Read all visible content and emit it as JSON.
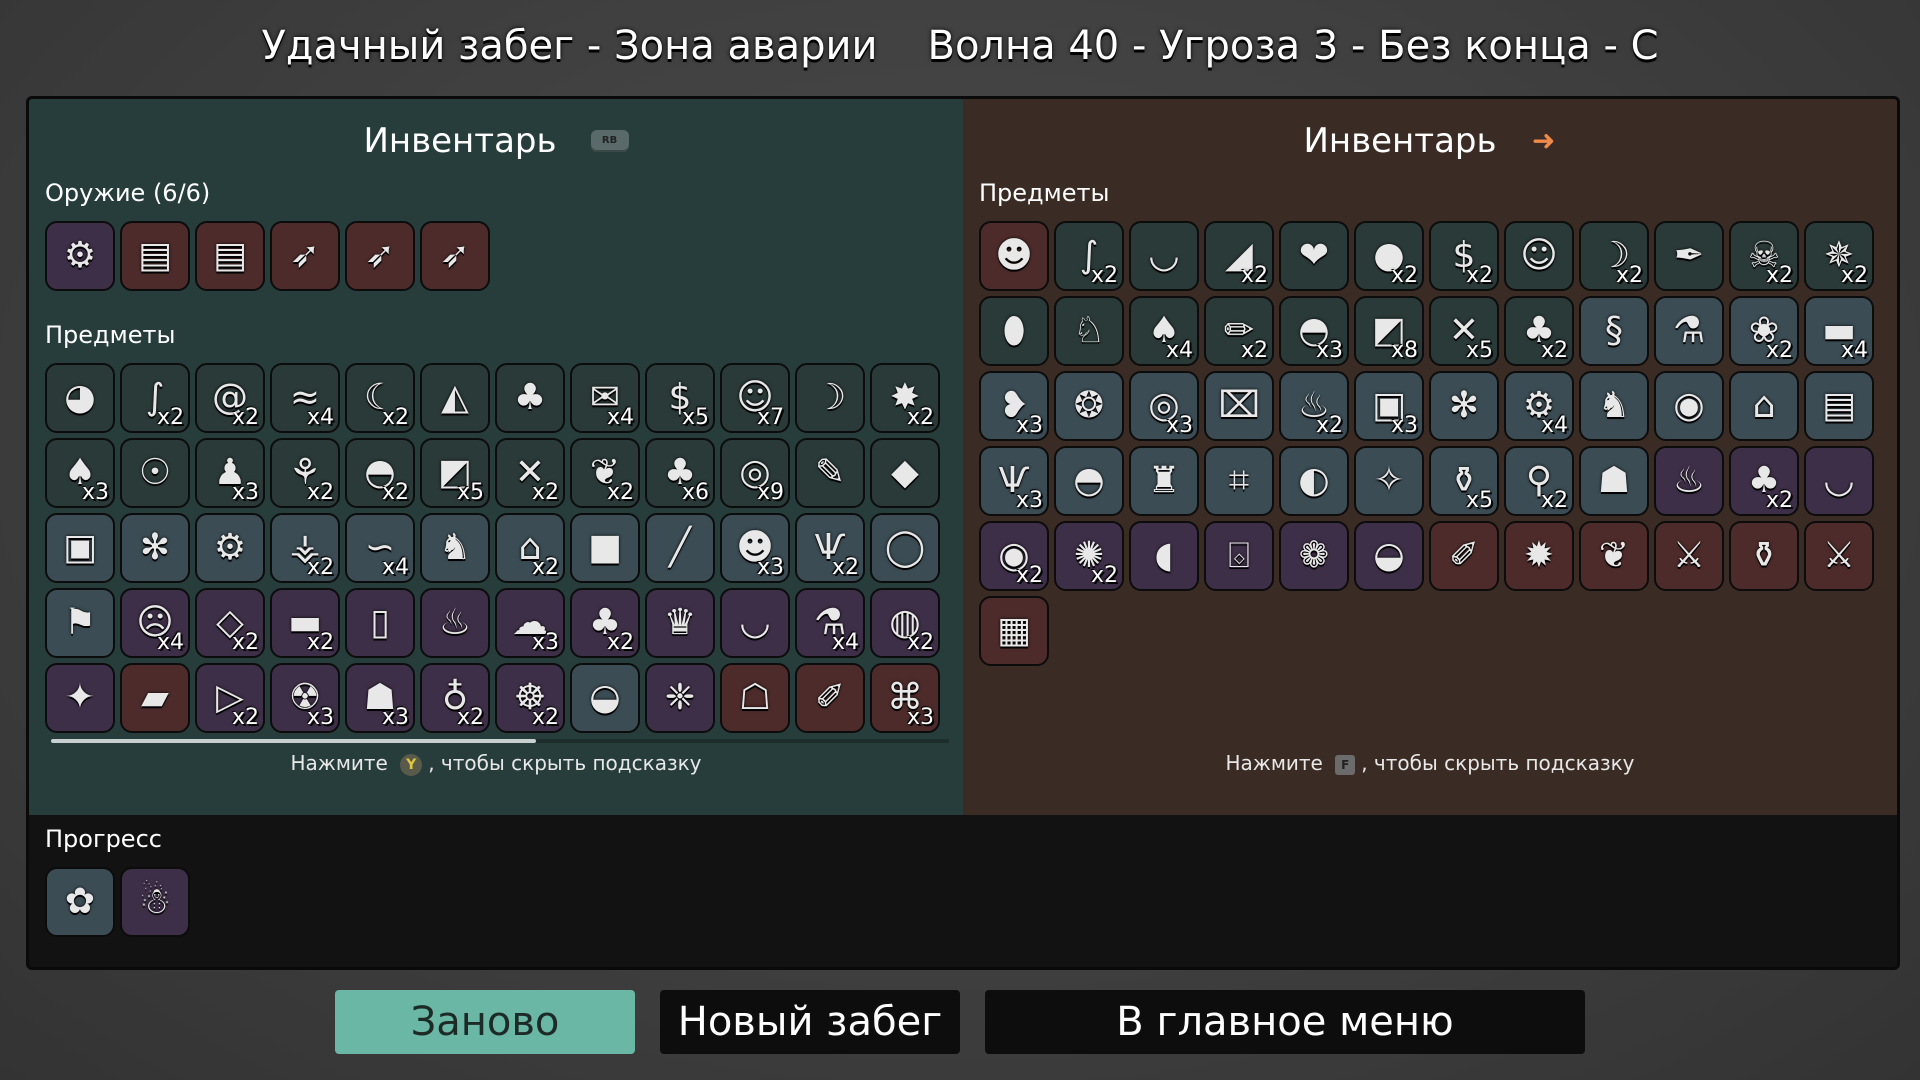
{
  "title": {
    "left": "Удачный забег - Зона аварии",
    "right": "Волна 40 - Угроза 3 - Без конца - С"
  },
  "left_panel": {
    "header": "Инвентарь",
    "header_chip": "RB",
    "weapons_label": "Оружие (6/6)",
    "weapons": [
      {
        "icon": "minigun-icon",
        "glyph": "⚙",
        "tier": 2
      },
      {
        "icon": "gatling-icon",
        "glyph": "▤",
        "tier": 3
      },
      {
        "icon": "gatling-icon",
        "glyph": "▤",
        "tier": 3
      },
      {
        "icon": "rocket-launcher-icon",
        "glyph": "➶",
        "tier": 3
      },
      {
        "icon": "rocket-launcher-icon",
        "glyph": "➶",
        "tier": 3
      },
      {
        "icon": "rocket-launcher-icon",
        "glyph": "➶",
        "tier": 3
      }
    ],
    "items_label": "Предметы",
    "items": [
      {
        "icon": "egg-glasses-icon",
        "glyph": "◕",
        "count": "",
        "tier": 0
      },
      {
        "icon": "worm-icon",
        "glyph": "∫",
        "count": "x2",
        "tier": 0
      },
      {
        "icon": "snail-icon",
        "glyph": "@",
        "count": "x2",
        "tier": 0
      },
      {
        "icon": "lizard-icon",
        "glyph": "≈",
        "count": "x4",
        "tier": 0
      },
      {
        "icon": "claw-icon",
        "glyph": "☾",
        "count": "x2",
        "tier": 0
      },
      {
        "icon": "cake-icon",
        "glyph": "◭",
        "count": "",
        "tier": 0
      },
      {
        "icon": "palm-tree-icon",
        "glyph": "♣",
        "count": "",
        "tier": 0
      },
      {
        "icon": "scroll-icon",
        "glyph": "✉",
        "count": "x4",
        "tier": 0
      },
      {
        "icon": "cash-icon",
        "glyph": "$",
        "count": "x5",
        "tier": 0
      },
      {
        "icon": "monkey-icon",
        "glyph": "☺",
        "count": "x7",
        "tier": 0
      },
      {
        "icon": "crescent-icon",
        "glyph": "☽",
        "count": "",
        "tier": 0
      },
      {
        "icon": "dynamite-icon",
        "glyph": "✸",
        "count": "x2",
        "tier": 0
      },
      {
        "icon": "mushroom-icon",
        "glyph": "♠",
        "count": "x3",
        "tier": 0
      },
      {
        "icon": "ghost-icon",
        "glyph": "☉",
        "count": "",
        "tier": 0
      },
      {
        "icon": "penguin-icon",
        "glyph": "♟",
        "count": "x3",
        "tier": 0
      },
      {
        "icon": "sprout-icon",
        "glyph": "⚘",
        "count": "x2",
        "tier": 0
      },
      {
        "icon": "propeller-hat-icon",
        "glyph": "◓",
        "count": "x2",
        "tier": 0
      },
      {
        "icon": "cheese-icon",
        "glyph": "◩",
        "count": "x5",
        "tier": 0
      },
      {
        "icon": "branch-icon",
        "glyph": "✕",
        "count": "x2",
        "tier": 0
      },
      {
        "icon": "meat-icon",
        "glyph": "❦",
        "count": "x2",
        "tier": 0
      },
      {
        "icon": "tree-icon",
        "glyph": "♣",
        "count": "x6",
        "tier": 0
      },
      {
        "icon": "medal-icon",
        "glyph": "◎",
        "count": "x9",
        "tier": 0
      },
      {
        "icon": "tag-icon",
        "glyph": "✎",
        "count": "",
        "tier": 0
      },
      {
        "icon": "whistle-icon",
        "glyph": "◆",
        "count": "",
        "tier": 0
      },
      {
        "icon": "box-icon",
        "glyph": "▣",
        "count": "",
        "tier": 1
      },
      {
        "icon": "wasp-icon",
        "glyph": "✻",
        "count": "",
        "tier": 1
      },
      {
        "icon": "gear-icon",
        "glyph": "⚙",
        "count": "",
        "tier": 1
      },
      {
        "icon": "coral-icon",
        "glyph": "⚶",
        "count": "x2",
        "tier": 1
      },
      {
        "icon": "larva-icon",
        "glyph": "∽",
        "count": "x4",
        "tier": 1
      },
      {
        "icon": "rabbit-icon",
        "glyph": "♞",
        "count": "",
        "tier": 1
      },
      {
        "icon": "planter-icon",
        "glyph": "⌂",
        "count": "x2",
        "tier": 1
      },
      {
        "icon": "ice-cube-icon",
        "glyph": "■",
        "count": "",
        "tier": 1
      },
      {
        "icon": "plank-icon",
        "glyph": "╱",
        "count": "",
        "tier": 1
      },
      {
        "icon": "frog-icon",
        "glyph": "☻",
        "count": "x3",
        "tier": 1
      },
      {
        "icon": "horns-icon",
        "glyph": "Ѱ",
        "count": "x2",
        "tier": 1
      },
      {
        "icon": "pendant-icon",
        "glyph": "◯",
        "count": "",
        "tier": 1
      },
      {
        "icon": "flag-icon",
        "glyph": "⚑",
        "count": "",
        "tier": 1
      },
      {
        "icon": "imp-icon",
        "glyph": "☹",
        "count": "x4",
        "tier": 2
      },
      {
        "icon": "eraser-icon",
        "glyph": "◇",
        "count": "x2",
        "tier": 2
      },
      {
        "icon": "log-icon",
        "glyph": "▬",
        "count": "x2",
        "tier": 2
      },
      {
        "icon": "mirror-icon",
        "glyph": "▯",
        "count": "",
        "tier": 2
      },
      {
        "icon": "candle-icon",
        "glyph": "♨",
        "count": "",
        "tier": 2
      },
      {
        "icon": "cloud-icon",
        "glyph": "☁",
        "count": "x3",
        "tier": 2
      },
      {
        "icon": "clover-icon",
        "glyph": "♣",
        "count": "x2",
        "tier": 2
      },
      {
        "icon": "crown-icon",
        "glyph": "♛",
        "count": "",
        "tier": 2
      },
      {
        "icon": "ramen-bowl-icon",
        "glyph": "◡",
        "count": "",
        "tier": 2
      },
      {
        "icon": "bottle-icon",
        "glyph": "⚗",
        "count": "x4",
        "tier": 2
      },
      {
        "icon": "fishbowl-icon",
        "glyph": "◍",
        "count": "x2",
        "tier": 2
      },
      {
        "icon": "chicken-icon",
        "glyph": "✦",
        "count": "",
        "tier": 2
      },
      {
        "icon": "toolbox-icon",
        "glyph": "▰",
        "count": "",
        "tier": 3
      },
      {
        "icon": "triangle-icon",
        "glyph": "▷",
        "count": "x2",
        "tier": 2
      },
      {
        "icon": "alien-icon",
        "glyph": "☢",
        "count": "x3",
        "tier": 2
      },
      {
        "icon": "ninja-icon",
        "glyph": "☗",
        "count": "x3",
        "tier": 2
      },
      {
        "icon": "potion-icon",
        "glyph": "♁",
        "count": "x2",
        "tier": 2
      },
      {
        "icon": "angel-icon",
        "glyph": "☸",
        "count": "x2",
        "tier": 2
      },
      {
        "icon": "helmet-icon",
        "glyph": "◒",
        "count": "",
        "tier": 1
      },
      {
        "icon": "wings-icon",
        "glyph": "❈",
        "count": "",
        "tier": 2
      },
      {
        "icon": "head-icon",
        "glyph": "☖",
        "count": "",
        "tier": 3
      },
      {
        "icon": "scroll-rolled-icon",
        "glyph": "✐",
        "count": "",
        "tier": 3
      },
      {
        "icon": "robot-frame-icon",
        "glyph": "⌘",
        "count": "x3",
        "tier": 3
      }
    ],
    "hint_prefix": "Нажмите",
    "hint_button": "Y",
    "hint_suffix": ", чтобы скрыть подсказку",
    "scroll_fraction": 0.54
  },
  "right_panel": {
    "header": "Инвентарь",
    "header_icon": "arrow-right-icon",
    "items_label": "Предметы",
    "items": [
      {
        "icon": "character-face-icon",
        "glyph": "☻",
        "count": "",
        "tier": 3
      },
      {
        "icon": "worm-icon",
        "glyph": "∫",
        "count": "x2",
        "tier": 0
      },
      {
        "icon": "cauldron-icon",
        "glyph": "◡",
        "count": "",
        "tier": 0
      },
      {
        "icon": "blade-icon",
        "glyph": "◢",
        "count": "x2",
        "tier": 0
      },
      {
        "icon": "red-gem-icon",
        "glyph": "❤",
        "count": "",
        "tier": 0
      },
      {
        "icon": "rock-icon",
        "glyph": "●",
        "count": "x2",
        "tier": 0
      },
      {
        "icon": "cash-icon",
        "glyph": "$",
        "count": "x2",
        "tier": 0
      },
      {
        "icon": "monkey-icon",
        "glyph": "☺",
        "count": "",
        "tier": 0
      },
      {
        "icon": "crescent-icon",
        "glyph": "☽",
        "count": "x2",
        "tier": 0
      },
      {
        "icon": "feather-icon",
        "glyph": "✒",
        "count": "",
        "tier": 0
      },
      {
        "icon": "skull-icon",
        "glyph": "☠",
        "count": "x2",
        "tier": 0
      },
      {
        "icon": "hedgehog-icon",
        "glyph": "✵",
        "count": "x2",
        "tier": 0
      },
      {
        "icon": "egg-icon",
        "glyph": "⬮",
        "count": "",
        "tier": 0
      },
      {
        "icon": "duck-icon",
        "glyph": "♘",
        "count": "",
        "tier": 0
      },
      {
        "icon": "mushroom-icon",
        "glyph": "♠",
        "count": "x4",
        "tier": 0
      },
      {
        "icon": "pencil-icon",
        "glyph": "✏",
        "count": "x2",
        "tier": 0
      },
      {
        "icon": "propeller-hat-icon",
        "glyph": "◓",
        "count": "x3",
        "tier": 0
      },
      {
        "icon": "cheese-icon",
        "glyph": "◩",
        "count": "x8",
        "tier": 0
      },
      {
        "icon": "branch-icon",
        "glyph": "✕",
        "count": "x5",
        "tier": 0
      },
      {
        "icon": "tree-icon",
        "glyph": "♣",
        "count": "x2",
        "tier": 0
      },
      {
        "icon": "snake-icon",
        "glyph": "§",
        "count": "",
        "tier": 1
      },
      {
        "icon": "flask-icon",
        "glyph": "⚗",
        "count": "",
        "tier": 1
      },
      {
        "icon": "octopus-icon",
        "glyph": "❀",
        "count": "x2",
        "tier": 1
      },
      {
        "icon": "belt-icon",
        "glyph": "▬",
        "count": "x4",
        "tier": 1
      },
      {
        "icon": "heart-organ-icon",
        "glyph": "❥",
        "count": "x3",
        "tier": 1
      },
      {
        "icon": "cocoon-icon",
        "glyph": "❂",
        "count": "",
        "tier": 1
      },
      {
        "icon": "donut-icon",
        "glyph": "◎",
        "count": "x3",
        "tier": 1
      },
      {
        "icon": "detonator-icon",
        "glyph": "⌧",
        "count": "",
        "tier": 1
      },
      {
        "icon": "campfire-icon",
        "glyph": "♨",
        "count": "x2",
        "tier": 1
      },
      {
        "icon": "box-icon",
        "glyph": "▣",
        "count": "x3",
        "tier": 1
      },
      {
        "icon": "wasp-icon",
        "glyph": "✻",
        "count": "",
        "tier": 1
      },
      {
        "icon": "gear-icon",
        "glyph": "⚙",
        "count": "x4",
        "tier": 1
      },
      {
        "icon": "rabbit-icon",
        "glyph": "♞",
        "count": "",
        "tier": 1
      },
      {
        "icon": "target-ring-icon",
        "glyph": "◉",
        "count": "",
        "tier": 1
      },
      {
        "icon": "planter-icon",
        "glyph": "⌂",
        "count": "",
        "tier": 1
      },
      {
        "icon": "torn-paper-icon",
        "glyph": "▤",
        "count": "",
        "tier": 1
      },
      {
        "icon": "horns-icon",
        "glyph": "Ѱ",
        "count": "x3",
        "tier": 1
      },
      {
        "icon": "hat-icon",
        "glyph": "◓",
        "count": "",
        "tier": 1
      },
      {
        "icon": "castle-icon",
        "glyph": "♜",
        "count": "",
        "tier": 1
      },
      {
        "icon": "machine-icon",
        "glyph": "⌗",
        "count": "",
        "tier": 1
      },
      {
        "icon": "barrel-icon",
        "glyph": "◐",
        "count": "",
        "tier": 1
      },
      {
        "icon": "spike-icon",
        "glyph": "✧",
        "count": "",
        "tier": 1
      },
      {
        "icon": "vial-icon",
        "glyph": "⚱",
        "count": "x5",
        "tier": 1
      },
      {
        "icon": "telescope-icon",
        "glyph": "⚲",
        "count": "x2",
        "tier": 1
      },
      {
        "icon": "spacesuit-icon",
        "glyph": "☗",
        "count": "",
        "tier": 1
      },
      {
        "icon": "candle-icon",
        "glyph": "♨",
        "count": "",
        "tier": 2
      },
      {
        "icon": "clover-icon",
        "glyph": "♣",
        "count": "x2",
        "tier": 2
      },
      {
        "icon": "ramen-bowl-icon",
        "glyph": "◡",
        "count": "",
        "tier": 2
      },
      {
        "icon": "eye-orb-icon",
        "glyph": "◉",
        "count": "x2",
        "tier": 2
      },
      {
        "icon": "peacock-icon",
        "glyph": "✺",
        "count": "x2",
        "tier": 2
      },
      {
        "icon": "baby-bottle-icon",
        "glyph": "◖",
        "count": "",
        "tier": 2
      },
      {
        "icon": "gift-box-icon",
        "glyph": "⌺",
        "count": "",
        "tier": 2
      },
      {
        "icon": "tardigrade-icon",
        "glyph": "❁",
        "count": "",
        "tier": 2
      },
      {
        "icon": "helmet-icon",
        "glyph": "◒",
        "count": "",
        "tier": 2
      },
      {
        "icon": "scroll-rolled-icon",
        "glyph": "✐",
        "count": "",
        "tier": 3
      },
      {
        "icon": "torch-icon",
        "glyph": "✹",
        "count": "",
        "tier": 3
      },
      {
        "icon": "rainbow-leaf-icon",
        "glyph": "❦",
        "count": "",
        "tier": 3
      },
      {
        "icon": "crossed-tools-icon",
        "glyph": "⚔",
        "count": "",
        "tier": 3
      },
      {
        "icon": "lantern-icon",
        "glyph": "⚱",
        "count": "",
        "tier": 3
      },
      {
        "icon": "sword-icon",
        "glyph": "⚔",
        "count": "",
        "tier": 3
      },
      {
        "icon": "hay-bale-icon",
        "glyph": "▦",
        "count": "",
        "tier": 3
      }
    ],
    "hint_prefix": "Нажмите",
    "hint_button": "F",
    "hint_suffix": ", чтобы скрыть подсказку"
  },
  "progress": {
    "label": "Прогресс",
    "items": [
      {
        "icon": "daisy-icon",
        "glyph": "✿",
        "tier": 1
      },
      {
        "icon": "mushrooms-icon",
        "glyph": "☃",
        "tier": 2
      }
    ]
  },
  "buttons": {
    "retry": "Заново",
    "new_run": "Новый забег",
    "main_menu": "В главное меню"
  },
  "colors": {
    "left_bg": "#263d3c",
    "right_bg": "#3a2c25",
    "retry_bg": "#6ab7a6"
  }
}
